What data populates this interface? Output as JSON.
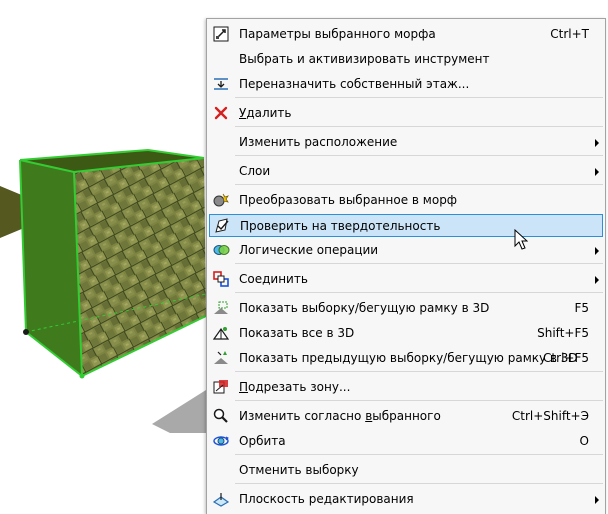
{
  "colors": {
    "menu_background": "#f7f7f7",
    "menu_border": "#a3a3a3",
    "highlight_fill": "#cce4f7",
    "highlight_border": "#2d8fd8",
    "selection_outline": "#33cc33"
  },
  "context_menu": {
    "highlighted_item": "check-solidity",
    "items": [
      {
        "id": "morph-settings",
        "icon": "morph-settings-icon",
        "before": "Параметры выбранного морфа",
        "accent": "",
        "after": "",
        "shortcut": "Ctrl+T",
        "submenu": false,
        "separator_after": false
      },
      {
        "id": "select-activate-tool",
        "icon": "",
        "before": "Выбрать и активизировать инструмент",
        "accent": "",
        "after": "",
        "shortcut": "",
        "submenu": false,
        "separator_after": false
      },
      {
        "id": "reassign-home-story",
        "icon": "story-icon",
        "before": "Переназначить собственный этаж...",
        "accent": "",
        "after": "",
        "shortcut": "",
        "submenu": false,
        "separator_after": true
      },
      {
        "id": "delete",
        "icon": "delete-icon",
        "before": "",
        "accent": "У",
        "after": "далить",
        "shortcut": "",
        "submenu": false,
        "separator_after": true
      },
      {
        "id": "arrange",
        "icon": "",
        "before": "Изменить расположение",
        "accent": "",
        "after": "",
        "shortcut": "",
        "submenu": true,
        "separator_after": true
      },
      {
        "id": "layers",
        "icon": "",
        "before": "Слои",
        "accent": "",
        "after": "",
        "shortcut": "",
        "submenu": true,
        "separator_after": true
      },
      {
        "id": "convert-to-morph",
        "icon": "convert-morph-icon",
        "before": "Преобразовать выбранное в морф",
        "accent": "",
        "after": "",
        "shortcut": "",
        "submenu": false,
        "separator_after": false
      },
      {
        "id": "check-solidity",
        "icon": "check-solidity-icon",
        "before": "Проверить на твердотельность",
        "accent": "",
        "after": "",
        "shortcut": "",
        "submenu": false,
        "separator_after": false
      },
      {
        "id": "boolean-operations",
        "icon": "boolean-icon",
        "before": "Логические операции",
        "accent": "",
        "after": "",
        "shortcut": "",
        "submenu": true,
        "separator_after": true
      },
      {
        "id": "connect",
        "icon": "connect-icon",
        "before": "Соединить",
        "accent": "",
        "after": "",
        "shortcut": "",
        "submenu": true,
        "separator_after": true
      },
      {
        "id": "show-selection-3d",
        "icon": "show-selection-3d-icon",
        "before": "Показать выборку/бегущую рамку в 3D",
        "accent": "",
        "after": "",
        "shortcut": "F5",
        "submenu": false,
        "separator_after": false
      },
      {
        "id": "show-all-3d",
        "icon": "show-all-3d-icon",
        "before": "Показать все в 3D",
        "accent": "",
        "after": "",
        "shortcut": "Shift+F5",
        "submenu": false,
        "separator_after": false
      },
      {
        "id": "show-previous-3d",
        "icon": "show-previous-3d-icon",
        "before": "Показать предыдущую выборку/бегущую рамку в 3D",
        "accent": "",
        "after": "",
        "shortcut": "Ctrl+F5",
        "submenu": false,
        "separator_after": true
      },
      {
        "id": "trim-zone",
        "icon": "trim-zone-icon",
        "before": "",
        "accent": "П",
        "after": "одрезать зону...",
        "shortcut": "",
        "submenu": false,
        "separator_after": true
      },
      {
        "id": "modify-selected",
        "icon": "modify-selected-icon",
        "before": "Изменить согласно ",
        "accent": "в",
        "after": "ыбранного",
        "shortcut": "Ctrl+Shift+Э",
        "submenu": false,
        "separator_after": false
      },
      {
        "id": "orbit",
        "icon": "orbit-icon",
        "before": "Орбита",
        "accent": "",
        "after": "",
        "shortcut": "O",
        "submenu": false,
        "separator_after": true
      },
      {
        "id": "deselect",
        "icon": "",
        "before": "Отменить выборку",
        "accent": "",
        "after": "",
        "shortcut": "",
        "submenu": false,
        "separator_after": true
      },
      {
        "id": "editing-plane",
        "icon": "editing-plane-icon",
        "before": "Плоскость редактирования",
        "accent": "",
        "after": "",
        "shortcut": "",
        "submenu": true,
        "separator_after": false
      }
    ]
  }
}
